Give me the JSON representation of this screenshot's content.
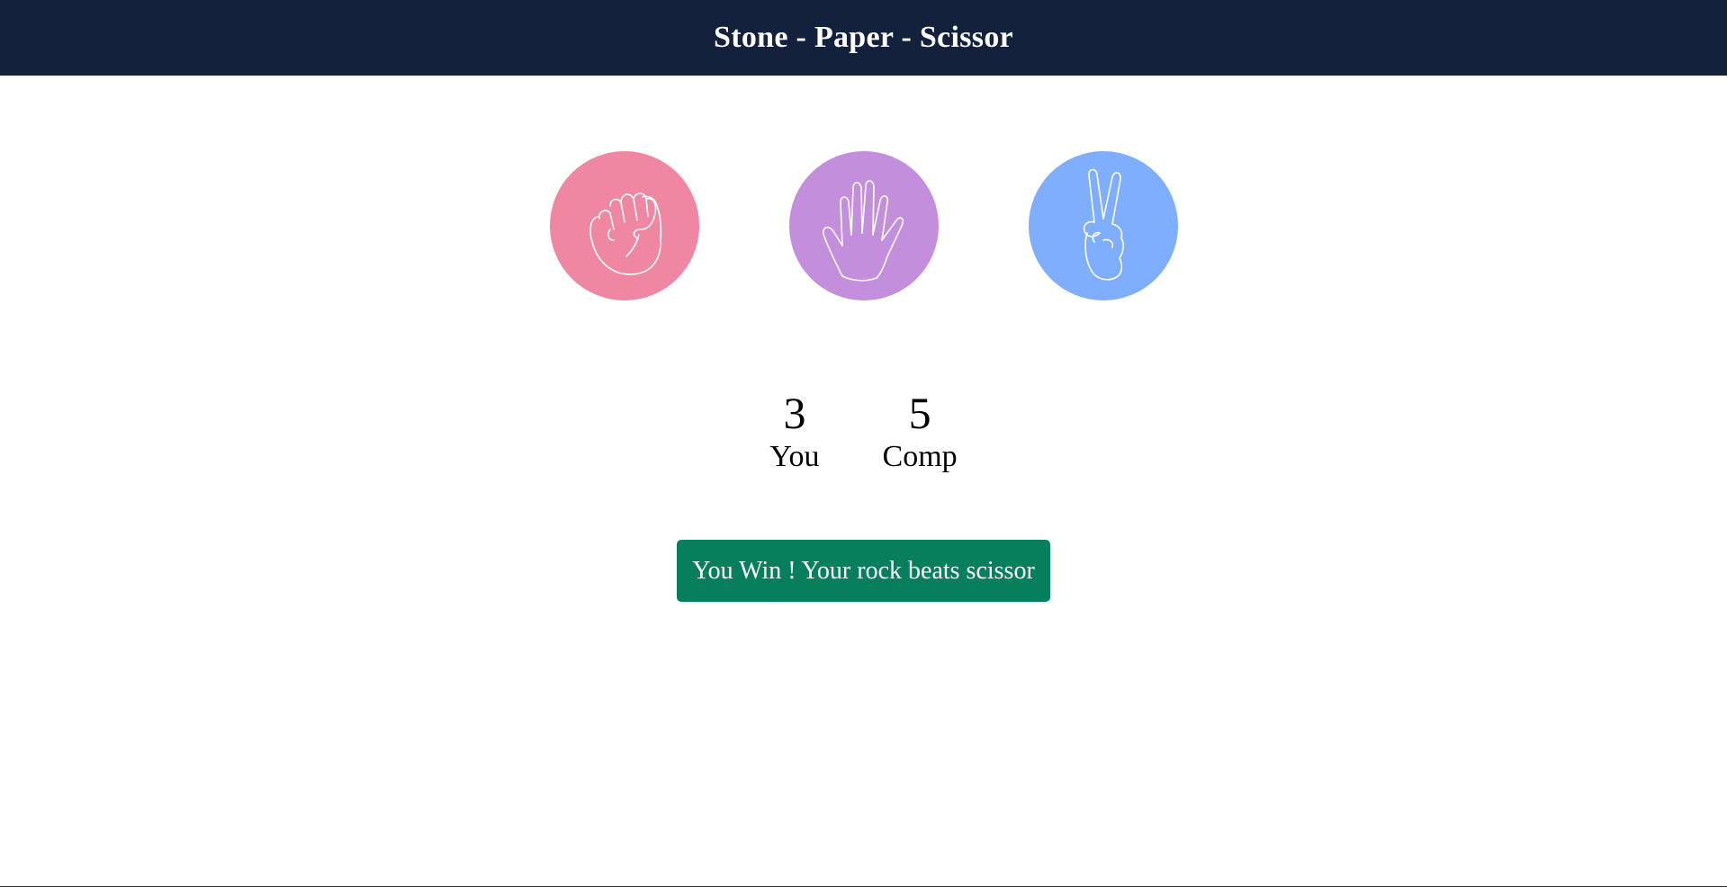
{
  "header": {
    "title": "Stone - Paper - Scissor"
  },
  "choices": [
    {
      "id": "rock",
      "icon": "rock-fist-icon",
      "color": "#f087a2"
    },
    {
      "id": "paper",
      "icon": "paper-open-hand-icon",
      "color": "#c38fdc"
    },
    {
      "id": "scissor",
      "icon": "scissor-peace-hand-icon",
      "color": "#80aeff"
    }
  ],
  "score": {
    "user": {
      "value": "3",
      "label": "You"
    },
    "comp": {
      "value": "5",
      "label": "Comp"
    }
  },
  "message": {
    "text": "You Win ! Your rock beats scissor",
    "color": "#087f5b"
  },
  "colors": {
    "header_bg": "#14213d"
  }
}
